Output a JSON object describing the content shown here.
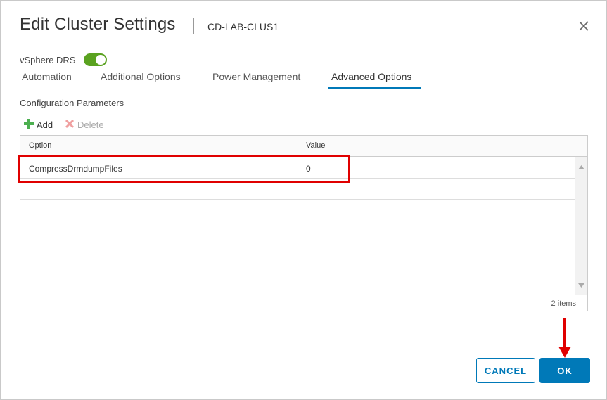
{
  "dialog": {
    "title": "Edit Cluster Settings",
    "subtitle": "CD-LAB-CLUS1"
  },
  "drs": {
    "label": "vSphere DRS",
    "enabled": true,
    "toggle_color": "#5aa220"
  },
  "tabs": [
    {
      "label": "Automation",
      "active": false
    },
    {
      "label": "Additional Options",
      "active": false
    },
    {
      "label": "Power Management",
      "active": false
    },
    {
      "label": "Advanced Options",
      "active": true
    }
  ],
  "config": {
    "section_label": "Configuration Parameters",
    "add_label": "Add",
    "delete_label": "Delete",
    "add_icon": "plus-icon",
    "delete_icon": "x-icon",
    "columns": [
      "Option",
      "Value"
    ],
    "rows": [
      {
        "option": "CompressDrmdumpFiles",
        "value": "0"
      },
      {
        "option": "",
        "value": ""
      }
    ],
    "item_count": "2 items"
  },
  "buttons": {
    "cancel": "CANCEL",
    "ok": "OK"
  },
  "colors": {
    "accent": "#0079b8",
    "annotation": "#e00000"
  }
}
